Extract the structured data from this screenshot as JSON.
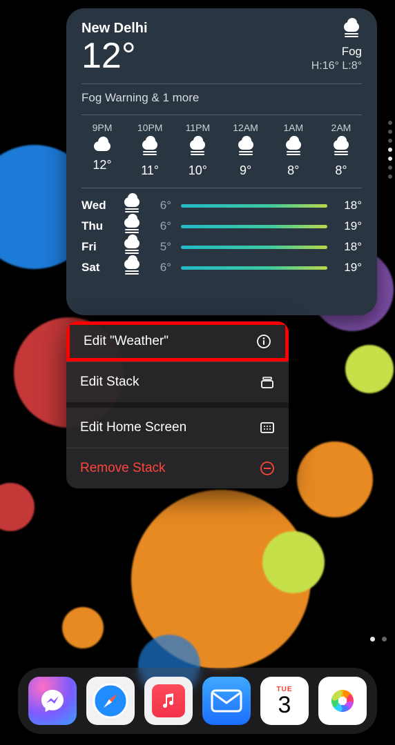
{
  "weather": {
    "location": "New Delhi",
    "temp": "12°",
    "condition": "Fog",
    "high_low": "H:16° L:8°",
    "alert": "Fog Warning & 1 more",
    "hourly": [
      {
        "time": "9PM",
        "icon": "cloud",
        "temp": "12°"
      },
      {
        "time": "10PM",
        "icon": "fog",
        "temp": "11°"
      },
      {
        "time": "11PM",
        "icon": "fog",
        "temp": "10°"
      },
      {
        "time": "12AM",
        "icon": "fog",
        "temp": "9°"
      },
      {
        "time": "1AM",
        "icon": "fog",
        "temp": "8°"
      },
      {
        "time": "2AM",
        "icon": "fog",
        "temp": "8°"
      }
    ],
    "daily": [
      {
        "day": "Wed",
        "icon": "fog",
        "lo": "6°",
        "hi": "18°"
      },
      {
        "day": "Thu",
        "icon": "fog",
        "lo": "6°",
        "hi": "19°"
      },
      {
        "day": "Fri",
        "icon": "fog",
        "lo": "5°",
        "hi": "18°"
      },
      {
        "day": "Sat",
        "icon": "fog",
        "lo": "6°",
        "hi": "19°"
      }
    ]
  },
  "menu": {
    "edit_weather": "Edit \"Weather\"",
    "edit_stack": "Edit Stack",
    "edit_home": "Edit Home Screen",
    "remove": "Remove Stack"
  },
  "calendar": {
    "weekday": "TUE",
    "day": "3"
  }
}
